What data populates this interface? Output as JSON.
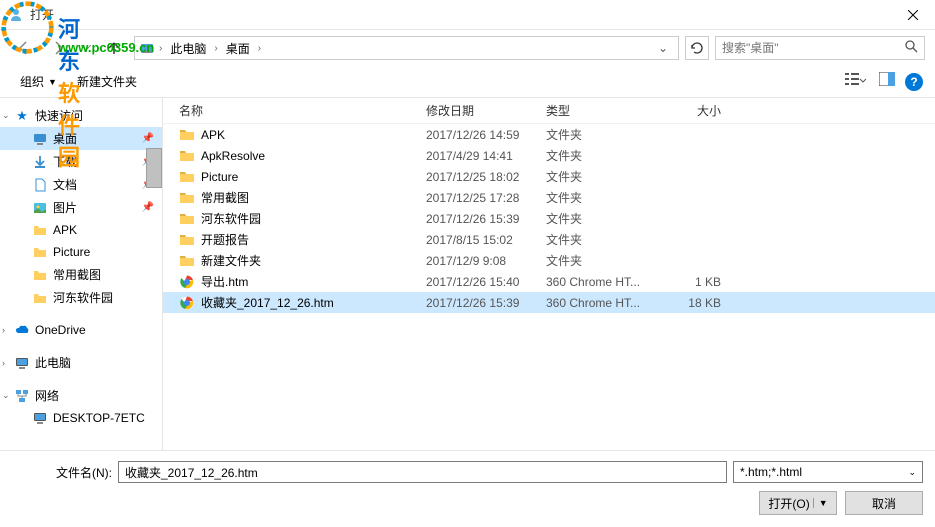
{
  "watermark": {
    "text1": "河东",
    "text2": "软件园",
    "url": "www.pc0359.cn"
  },
  "window": {
    "title": "打开"
  },
  "breadcrumb": {
    "items": [
      "此电脑",
      "桌面"
    ]
  },
  "search": {
    "placeholder": "搜索\"桌面\""
  },
  "toolbar": {
    "organize": "组织",
    "new_folder": "新建文件夹"
  },
  "sidebar": {
    "quick_access": "快速访问",
    "desktop": "桌面",
    "downloads": "下载",
    "documents": "文档",
    "pictures": "图片",
    "apk": "APK",
    "picture_en": "Picture",
    "screenshots": "常用截图",
    "hedong": "河东软件园",
    "onedrive": "OneDrive",
    "this_pc": "此电脑",
    "network": "网络",
    "desktop_pc": "DESKTOP-7ETC"
  },
  "columns": {
    "name": "名称",
    "date": "修改日期",
    "type": "类型",
    "size": "大小"
  },
  "files": [
    {
      "name": "APK",
      "date": "2017/12/26 14:59",
      "type": "文件夹",
      "size": "",
      "icon": "folder"
    },
    {
      "name": "ApkResolve",
      "date": "2017/4/29 14:41",
      "type": "文件夹",
      "size": "",
      "icon": "folder"
    },
    {
      "name": "Picture",
      "date": "2017/12/25 18:02",
      "type": "文件夹",
      "size": "",
      "icon": "folder"
    },
    {
      "name": "常用截图",
      "date": "2017/12/25 17:28",
      "type": "文件夹",
      "size": "",
      "icon": "folder"
    },
    {
      "name": "河东软件园",
      "date": "2017/12/26 15:39",
      "type": "文件夹",
      "size": "",
      "icon": "folder"
    },
    {
      "name": "开题报告",
      "date": "2017/8/15 15:02",
      "type": "文件夹",
      "size": "",
      "icon": "folder"
    },
    {
      "name": "新建文件夹",
      "date": "2017/12/9 9:08",
      "type": "文件夹",
      "size": "",
      "icon": "folder"
    },
    {
      "name": "导出.htm",
      "date": "2017/12/26 15:40",
      "type": "360 Chrome HT...",
      "size": "1 KB",
      "icon": "chrome"
    },
    {
      "name": "收藏夹_2017_12_26.htm",
      "date": "2017/12/26 15:39",
      "type": "360 Chrome HT...",
      "size": "18 KB",
      "icon": "chrome",
      "selected": true
    }
  ],
  "footer": {
    "filename_label": "文件名(N):",
    "filename_value": "收藏夹_2017_12_26.htm",
    "filter": "*.htm;*.html",
    "open": "打开(O)",
    "cancel": "取消"
  }
}
